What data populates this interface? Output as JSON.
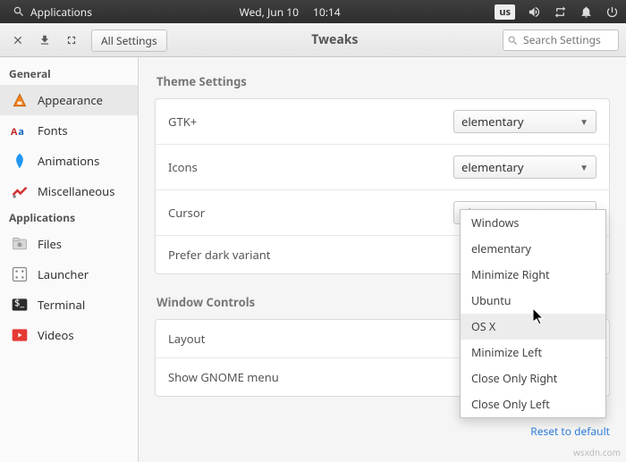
{
  "panel": {
    "applications": "Applications",
    "date": "Wed, Jun 10",
    "time": "10:14",
    "kbd": "us"
  },
  "toolbar": {
    "breadcrumb": "All Settings",
    "title": "Tweaks",
    "search_placeholder": "Search Settings"
  },
  "sidebar": {
    "header_general": "General",
    "appearance": "Appearance",
    "fonts": "Fonts",
    "animations": "Animations",
    "miscellaneous": "Miscellaneous",
    "header_applications": "Applications",
    "files": "Files",
    "launcher": "Launcher",
    "terminal": "Terminal",
    "videos": "Videos"
  },
  "content": {
    "theme_settings": "Theme Settings",
    "gtk": "GTK+",
    "gtk_value": "elementary",
    "icons": "Icons",
    "icons_value": "elementary",
    "cursor": "Cursor",
    "cursor_value": "elementary",
    "prefer_dark": "Prefer dark variant",
    "window_controls": "Window Controls",
    "layout": "Layout",
    "show_gnome": "Show GNOME menu"
  },
  "dropdown": {
    "items": {
      "0": "Windows",
      "1": "elementary",
      "2": "Minimize Right",
      "3": "Ubuntu",
      "4": "OS X",
      "5": "Minimize Left",
      "6": "Close Only Right",
      "7": "Close Only Left"
    }
  },
  "footer": {
    "reset": "Reset to default",
    "watermark": "wsxdn.com"
  }
}
